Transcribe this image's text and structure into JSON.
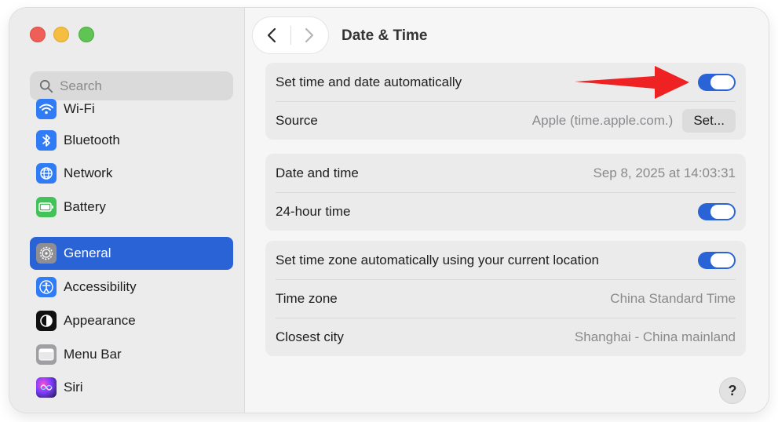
{
  "window": {
    "title": "Date & Time"
  },
  "search": {
    "placeholder": "Search"
  },
  "sidebar": {
    "items": [
      {
        "label": "Wi-Fi",
        "icon": "wifi-icon"
      },
      {
        "label": "Bluetooth",
        "icon": "bluetooth-icon"
      },
      {
        "label": "Network",
        "icon": "globe-icon"
      },
      {
        "label": "Battery",
        "icon": "battery-icon"
      },
      {
        "label": "General",
        "icon": "gear-icon",
        "selected": true
      },
      {
        "label": "Accessibility",
        "icon": "accessibility-icon"
      },
      {
        "label": "Appearance",
        "icon": "appearance-icon"
      },
      {
        "label": "Menu Bar",
        "icon": "menu-bar-icon"
      },
      {
        "label": "Siri",
        "icon": "siri-icon"
      }
    ]
  },
  "settings": {
    "auto_time": {
      "label": "Set time and date automatically",
      "on": true
    },
    "source": {
      "label": "Source",
      "value": "Apple (time.apple.com.)",
      "button": "Set..."
    },
    "date_time": {
      "label": "Date and time",
      "value": "Sep 8, 2025 at 14:03:31"
    },
    "hour24": {
      "label": "24-hour time",
      "on": true
    },
    "auto_zone": {
      "label": "Set time zone automatically using your current location",
      "on": true
    },
    "time_zone": {
      "label": "Time zone",
      "value": "China Standard Time"
    },
    "closest_city": {
      "label": "Closest city",
      "value": "Shanghai - China mainland"
    }
  },
  "help": {
    "label": "?"
  },
  "colors": {
    "accent": "#2a63d6",
    "annotation_arrow": "#ee2222"
  }
}
